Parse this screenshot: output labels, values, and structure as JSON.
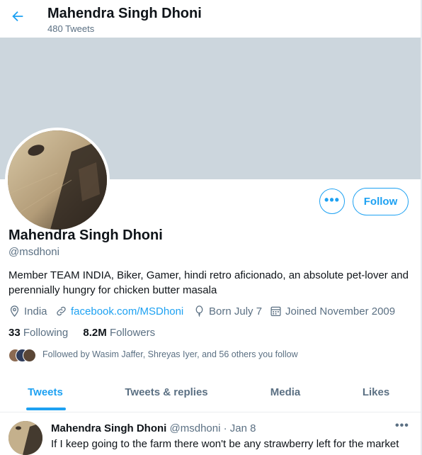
{
  "header": {
    "title": "Mahendra Singh Dhoni",
    "subtitle": "480 Tweets"
  },
  "actions": {
    "more_label": "•••",
    "follow_label": "Follow"
  },
  "profile": {
    "name": "Mahendra Singh Dhoni",
    "handle": "@msdhoni",
    "bio": "Member TEAM INDIA, Biker, Gamer, hindi retro aficionado, an absolute pet-lover and perennially hungry for chicken butter masala",
    "location": "India",
    "website": "facebook.com/MSDhoni",
    "birthday": "Born July 7",
    "joined": "Joined November 2009"
  },
  "stats": {
    "following_count": "33",
    "following_label": "Following",
    "followers_count": "8.2M",
    "followers_label": "Followers"
  },
  "followed_by": "Followed by Wasim Jaffer, Shreyas Iyer, and 56 others you follow",
  "tabs": [
    {
      "label": "Tweets",
      "active": true
    },
    {
      "label": "Tweets & replies",
      "active": false
    },
    {
      "label": "Media",
      "active": false
    },
    {
      "label": "Likes",
      "active": false
    }
  ],
  "tweet": {
    "author": "Mahendra Singh Dhoni",
    "handle": "@msdhoni",
    "date": "· Jan 8",
    "text": "If I keep going to the farm there won't be any strawberry left for the market"
  },
  "colors": {
    "accent": "#1da1f2",
    "banner": "#ccd6dd",
    "muted": "#5b7083"
  }
}
